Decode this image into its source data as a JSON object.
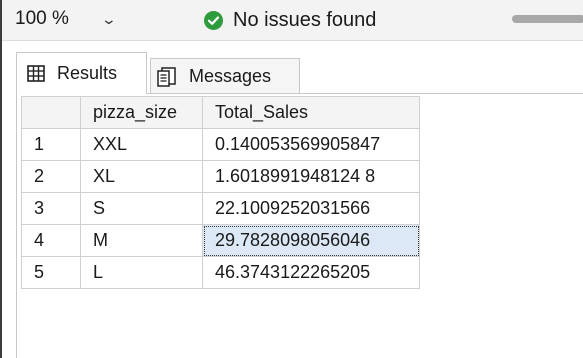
{
  "toolbar": {
    "zoom": "100 %",
    "status": "No issues found"
  },
  "tabs": [
    {
      "label": "Results"
    },
    {
      "label": "Messages"
    }
  ],
  "grid": {
    "columns": [
      "",
      "pizza_size",
      "Total_Sales"
    ],
    "rows": [
      {
        "n": "1",
        "pizza_size": "XXL",
        "total_sales": "0.140053569905847"
      },
      {
        "n": "2",
        "pizza_size": "XL",
        "total_sales": "1.6018991948124 8"
      },
      {
        "n": "3",
        "pizza_size": "S",
        "total_sales": "22.1009252031566"
      },
      {
        "n": "4",
        "pizza_size": "M",
        "total_sales": "29.7828098056046"
      },
      {
        "n": "5",
        "pizza_size": "L",
        "total_sales": "46.3743122265205"
      }
    ]
  },
  "colors": {
    "status_ok": "#2e9b3c",
    "selection": "#dce8f5"
  }
}
